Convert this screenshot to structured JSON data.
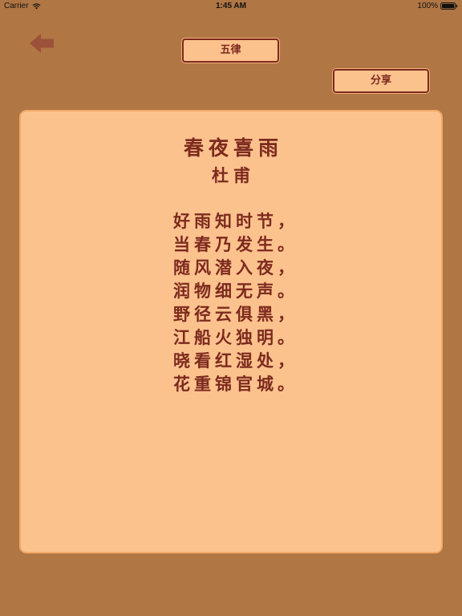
{
  "status_bar": {
    "carrier": "Carrier",
    "time": "1:45 AM",
    "battery": "100%"
  },
  "nav": {
    "back_icon": "back-arrow-icon"
  },
  "toolbar": {
    "form_label": "五律",
    "share_label": "分享"
  },
  "poem": {
    "title": "春夜喜雨",
    "author": "杜甫",
    "lines": [
      "好雨知时节，",
      "当春乃发生。",
      "随风潜入夜，",
      "润物细无声。",
      "野径云俱黑，",
      "江船火独明。",
      "晓看红湿处，",
      "花重锦官城。"
    ]
  },
  "colors": {
    "background": "#b07644",
    "card": "#fcc28e",
    "text": "#7d2a1e",
    "back_arrow": "#9a4a38"
  }
}
